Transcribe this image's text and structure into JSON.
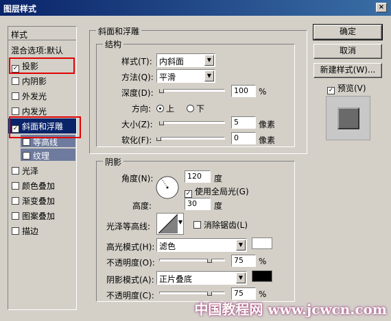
{
  "window": {
    "title": "图层样式",
    "close_label": "×"
  },
  "styles_panel": {
    "header": "样式",
    "blend_options": "混合选项:默认",
    "items": [
      {
        "label": "投影",
        "checked": true
      },
      {
        "label": "内阴影",
        "checked": false
      },
      {
        "label": "外发光",
        "checked": false
      },
      {
        "label": "内发光",
        "checked": false
      },
      {
        "label": "斜面和浮雕",
        "checked": true,
        "selected": true
      },
      {
        "label": "等高线",
        "checked": false,
        "sub": true
      },
      {
        "label": "纹理",
        "checked": false,
        "sub": true
      },
      {
        "label": "光泽",
        "checked": false
      },
      {
        "label": "颜色叠加",
        "checked": false
      },
      {
        "label": "渐变叠加",
        "checked": false
      },
      {
        "label": "图案叠加",
        "checked": false
      },
      {
        "label": "描边",
        "checked": false
      }
    ]
  },
  "bevel": {
    "section_title": "斜面和浮雕",
    "structure_title": "结构",
    "style_label": "样式(T):",
    "style_value": "内斜面",
    "technique_label": "方法(Q):",
    "technique_value": "平滑",
    "depth_label": "深度(D):",
    "depth_value": "100",
    "depth_pct": 0.05,
    "depth_unit": "%",
    "direction_label": "方向:",
    "dir_up": "上",
    "dir_down": "下",
    "size_label": "大小(Z):",
    "size_value": "5",
    "size_unit": "像素",
    "soften_label": "软化(F):",
    "soften_value": "0",
    "soften_unit": "像素"
  },
  "shading": {
    "title": "阴影",
    "angle_label": "角度(N):",
    "angle_value": "120",
    "angle_unit": "度",
    "global_light_label": "使用全局光(G)",
    "altitude_label": "高度:",
    "altitude_value": "30",
    "altitude_unit": "度",
    "gloss_label": "光泽等高线:",
    "antialias_label": "消除锯齿(L)",
    "highlight_mode_label": "高光模式(H):",
    "highlight_mode_value": "滤色",
    "highlight_color": "#ffffff",
    "highlight_opacity_label": "不透明度(O):",
    "highlight_opacity_value": "75",
    "highlight_opacity_unit": "%",
    "shadow_mode_label": "阴影模式(A):",
    "shadow_mode_value": "正片叠底",
    "shadow_color": "#000000",
    "shadow_opacity_label": "不透明度(C):",
    "shadow_opacity_value": "75",
    "shadow_opacity_unit": "%"
  },
  "buttons": {
    "ok": "确定",
    "cancel": "取消",
    "new_style": "新建样式(W)...",
    "preview": "预览(V)"
  },
  "watermark": "中国教程网 www.jcwcn.com"
}
